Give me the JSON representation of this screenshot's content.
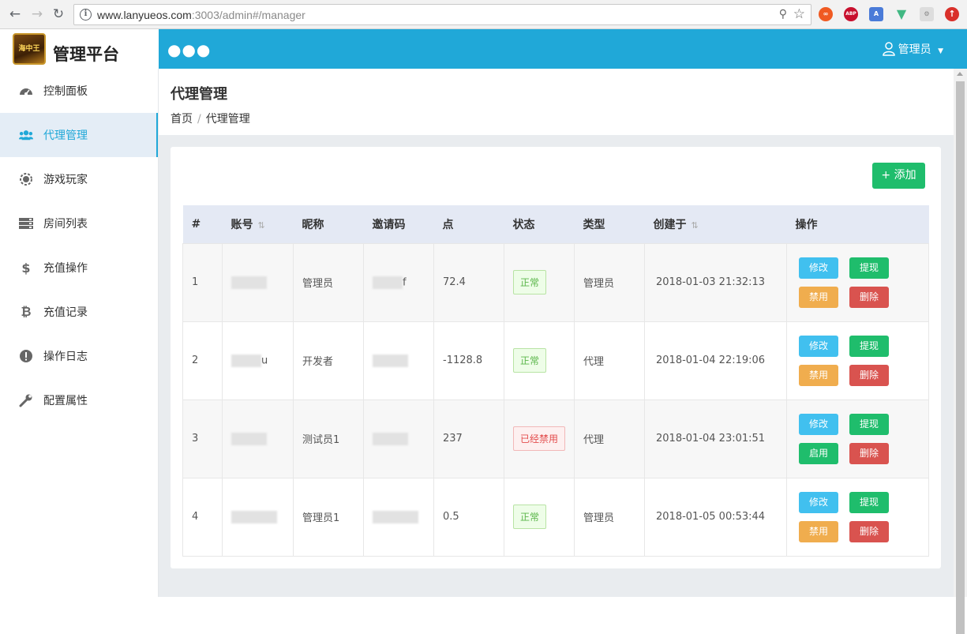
{
  "browser": {
    "url_host": "www.lanyueos.com",
    "url_rest": ":3003/admin#/manager"
  },
  "app": {
    "brand_title": "管理平台",
    "logo_text": "海中王",
    "user_label": "管理员"
  },
  "sidebar": {
    "items": [
      {
        "label": "控制面板",
        "icon": "dashboard-icon"
      },
      {
        "label": "代理管理",
        "icon": "users-icon",
        "active": true
      },
      {
        "label": "游戏玩家",
        "icon": "game-icon"
      },
      {
        "label": "房间列表",
        "icon": "server-icon"
      },
      {
        "label": "充值操作",
        "icon": "dollar-icon"
      },
      {
        "label": "充值记录",
        "icon": "bitcoin-icon"
      },
      {
        "label": "操作日志",
        "icon": "alert-icon"
      },
      {
        "label": "配置属性",
        "icon": "wrench-icon"
      }
    ]
  },
  "page": {
    "title": "代理管理",
    "breadcrumb": [
      "首页",
      "代理管理"
    ],
    "add_label": "+ 添加"
  },
  "table": {
    "headers": [
      "#",
      "账号",
      "昵称",
      "邀请码",
      "点",
      "状态",
      "类型",
      "创建于",
      "操作"
    ],
    "rows": [
      {
        "no": "1",
        "nickname": "管理员",
        "invite_suffix": "f",
        "points": "72.4",
        "status": "正常",
        "status_ok": true,
        "type": "管理员",
        "created": "2018-01-03 21:32:13",
        "op1": "修改",
        "op2": "提现",
        "op3": "禁用",
        "op4": "删除"
      },
      {
        "no": "2",
        "account_suffix": "u",
        "nickname": "开发者",
        "points": "-1128.8",
        "status": "正常",
        "status_ok": true,
        "type": "代理",
        "created": "2018-01-04 22:19:06",
        "op1": "修改",
        "op2": "提现",
        "op3": "禁用",
        "op4": "删除"
      },
      {
        "no": "3",
        "nickname": "测试员1",
        "points": "237",
        "status": "已经禁用",
        "status_ok": false,
        "type": "代理",
        "created": "2018-01-04 23:01:51",
        "op1": "修改",
        "op2": "提现",
        "op3": "启用",
        "op4": "删除"
      },
      {
        "no": "4",
        "nickname": "管理员1",
        "points": "0.5",
        "status": "正常",
        "status_ok": true,
        "type": "管理员",
        "created": "2018-01-05 00:53:44",
        "op1": "修改",
        "op2": "提现",
        "op3": "禁用",
        "op4": "删除"
      }
    ]
  },
  "colors": {
    "accent": "#20a8d8",
    "success": "#1fbd6c",
    "info": "#41c0ef",
    "warning": "#f0ad4e",
    "danger": "#d9534f"
  }
}
